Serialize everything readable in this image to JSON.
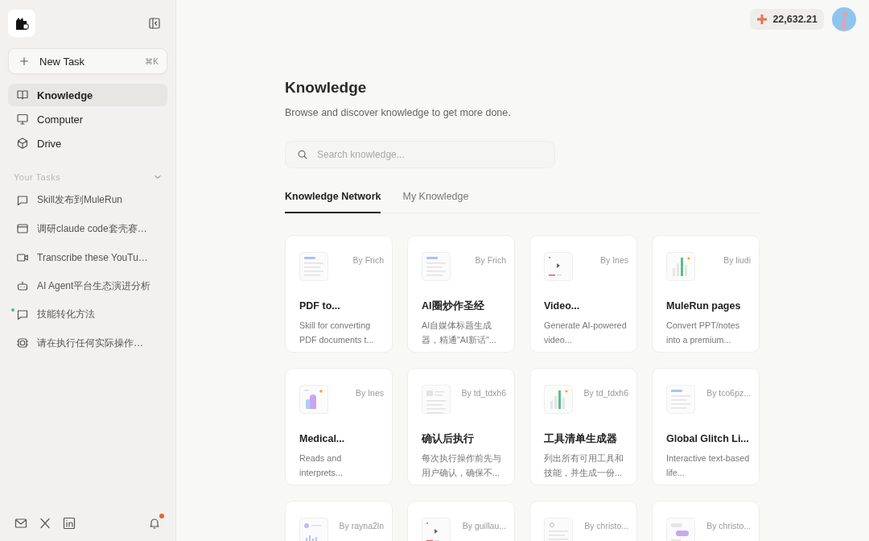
{
  "sidebar": {
    "new_task": {
      "label": "New Task",
      "shortcut": "⌘K"
    },
    "nav": [
      {
        "label": "Knowledge",
        "kind": "book",
        "selected": true
      },
      {
        "label": "Computer",
        "kind": "monitor",
        "selected": false
      },
      {
        "label": "Drive",
        "kind": "cube",
        "selected": false
      }
    ],
    "tasks_heading": "Your Tasks",
    "tasks": [
      {
        "label": "Skill发布到MuleRun",
        "kind": "chat",
        "unread": false
      },
      {
        "label": "调研claude code套壳赛…",
        "kind": "window",
        "unread": false
      },
      {
        "label": "Transcribe these YouTu…",
        "kind": "video",
        "unread": false
      },
      {
        "label": "AI Agent平台生态演进分析",
        "kind": "robot",
        "unread": false
      },
      {
        "label": "技能转化方法",
        "kind": "chat",
        "unread": true
      },
      {
        "label": "请在执行任何实际操作…",
        "kind": "chip",
        "unread": false
      }
    ],
    "notifications": {
      "unread": true
    }
  },
  "header": {
    "credits": "22,632.21"
  },
  "page": {
    "title": "Knowledge",
    "subtitle": "Browse and discover knowledge to get more done.",
    "search": {
      "placeholder": "Search knowledge..."
    },
    "tabs": [
      {
        "label": "Knowledge Network",
        "selected": true
      },
      {
        "label": "My Knowledge",
        "selected": false
      }
    ],
    "cards": [
      {
        "kind": "doc",
        "author": "By Frich",
        "title": "PDF to...",
        "description": "Skill for converting PDF documents t..."
      },
      {
        "kind": "doc",
        "author": "By Frich",
        "title": "AI圈炒作圣经",
        "description": "AI自媒体标题生成器，精通\"AI新话\"..."
      },
      {
        "kind": "video",
        "author": "By Ines",
        "title": "Video...",
        "description": "Generate AI-powered video..."
      },
      {
        "kind": "chart",
        "author": "By liudi",
        "title": "MuleRun pages",
        "description": "Convert PPT/notes into a premium..."
      },
      {
        "kind": "purple",
        "author": "By Ines",
        "title": "Medical...",
        "description": "Reads and interprets..."
      },
      {
        "kind": "form",
        "author": "By td_tdxh6",
        "title": "确认后执行",
        "description": "每次执行操作前先与用户确认，确保不..."
      },
      {
        "kind": "chart",
        "author": "By td_tdxh6",
        "title": "工具清单生成器",
        "description": "列出所有可用工具和技能，并生成一份..."
      },
      {
        "kind": "doc",
        "author": "By tco6pz...",
        "title": "Global Glitch Li...",
        "description": "Interactive text-based life..."
      },
      {
        "kind": "dots",
        "author": "By rayna2ln"
      },
      {
        "kind": "video",
        "author": "By guillau..."
      },
      {
        "kind": "search",
        "author": "By christo..."
      },
      {
        "kind": "pill",
        "author": "By christo..."
      }
    ]
  }
}
